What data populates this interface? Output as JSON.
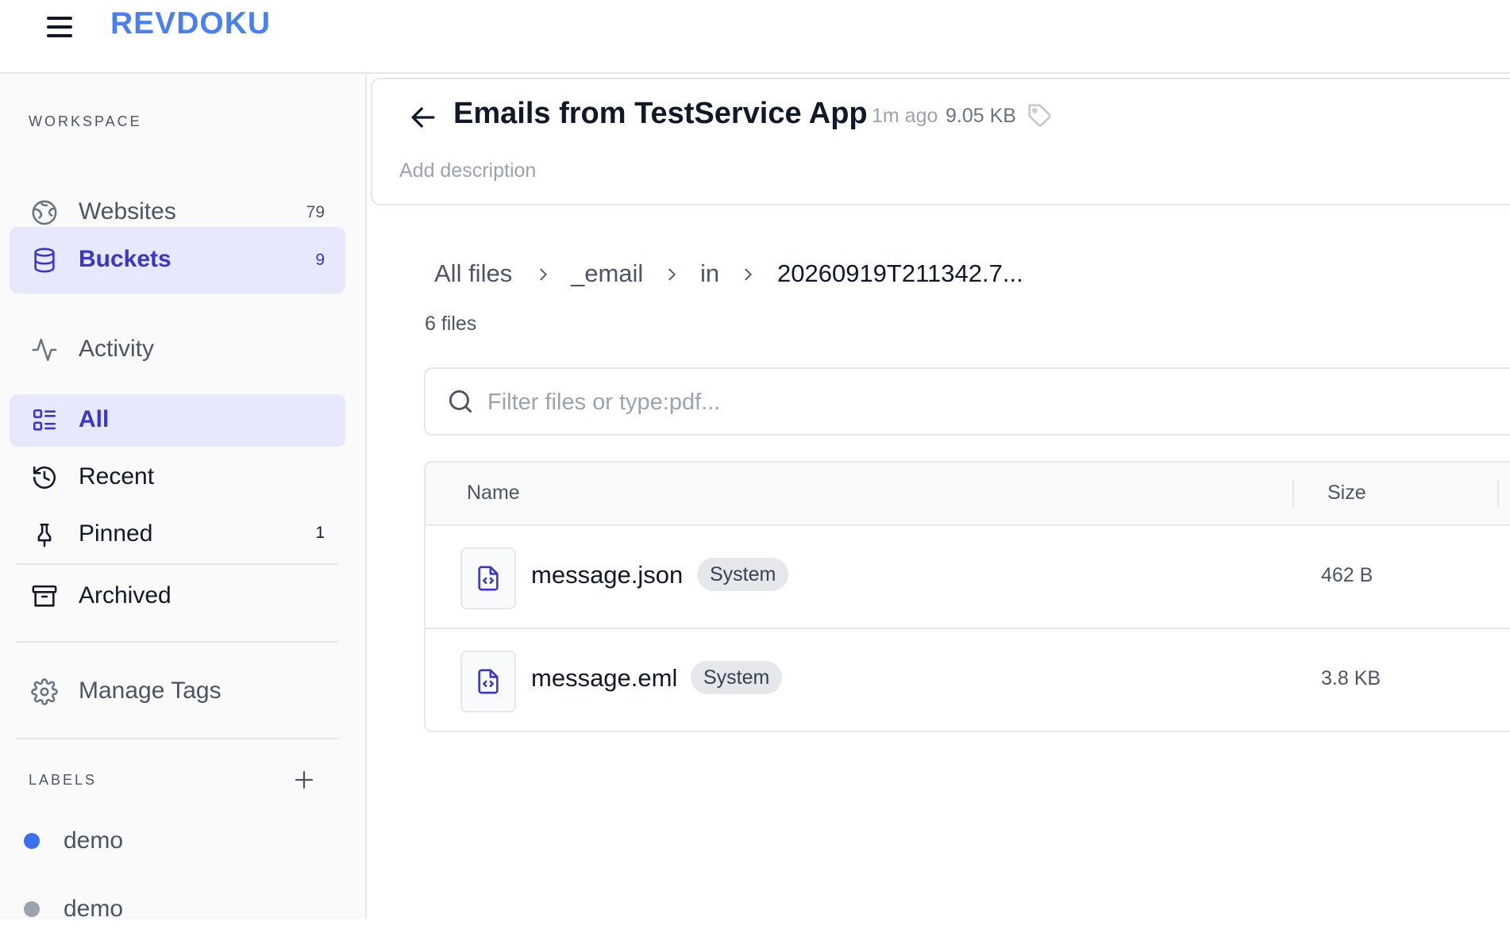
{
  "app": {
    "brand": "REVDOKU"
  },
  "sidebar": {
    "workspace_title": "WORKSPACE",
    "workspace_items": [
      {
        "label": "Websites",
        "count": "79",
        "icon": "globe-icon"
      },
      {
        "label": "Buckets",
        "count": "9",
        "icon": "database-icon",
        "active": true
      },
      {
        "label": "Activity",
        "count": "",
        "icon": "activity-icon"
      }
    ],
    "filter_items": [
      {
        "label": "All",
        "count": "",
        "icon": "list-icon",
        "active": true
      },
      {
        "label": "Recent",
        "count": "",
        "icon": "history-icon"
      },
      {
        "label": "Pinned",
        "count": "1",
        "icon": "pin-icon"
      },
      {
        "label": "Archived",
        "count": "",
        "icon": "archive-icon"
      }
    ],
    "manage_tags": {
      "label": "Manage Tags",
      "icon": "gear-icon"
    },
    "labels_title": "LABELS",
    "labels": [
      {
        "label": "demo",
        "color": "#3b6ff0"
      },
      {
        "label": "demo",
        "color": "#9ca3af"
      }
    ]
  },
  "header": {
    "title": "Emails from TestService App",
    "updated": "1m ago",
    "size": "9.05 KB",
    "description_placeholder": "Add description"
  },
  "breadcrumb": [
    "All files",
    "_email",
    "in",
    "20260919T211342.7..."
  ],
  "file_count": "6 files",
  "search": {
    "placeholder": "Filter files or type:pdf...",
    "value": ""
  },
  "table": {
    "columns": [
      "Name",
      "Size"
    ],
    "rows": [
      {
        "name": "message.json",
        "badge": "System",
        "size": "462 B",
        "icon": "file-code-icon"
      },
      {
        "name": "message.eml",
        "badge": "System",
        "size": "3.8 KB",
        "icon": "file-code-icon"
      }
    ]
  },
  "colors": {
    "accent": "#3b35c9",
    "brand": "#4a7ff0",
    "active_bg": "#e7e8fb"
  }
}
